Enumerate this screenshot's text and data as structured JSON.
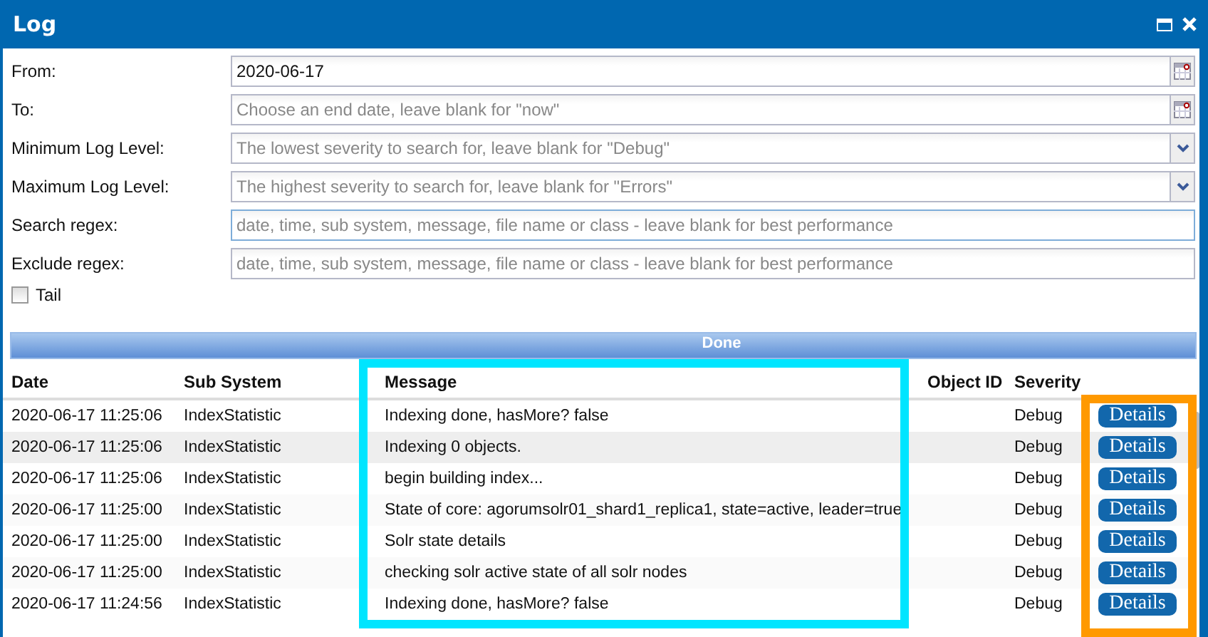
{
  "window": {
    "title": "Log",
    "buttons": [
      {
        "kind": "maximize"
      },
      {
        "kind": "close"
      }
    ]
  },
  "form": {
    "fields": [
      {
        "label": "From:",
        "kind": "date",
        "value": "2020-06-17",
        "focused": false
      },
      {
        "label": "To:",
        "kind": "date",
        "placeholder": "Choose an end date, leave blank for \"now\"",
        "focused": false
      },
      {
        "label": "Minimum Log Level:",
        "kind": "combo",
        "placeholder": "The lowest severity to search for, leave blank for \"Debug\"",
        "focused": false
      },
      {
        "label": "Maximum Log Level:",
        "kind": "combo",
        "placeholder": "The highest severity to search for, leave blank for \"Errors\"",
        "focused": false
      },
      {
        "label": "Search regex:",
        "kind": "text",
        "placeholder": "date, time, sub system, message, file name or class - leave blank for best performance",
        "focused": true
      },
      {
        "label": "Exclude regex:",
        "kind": "text",
        "placeholder": "date, time, sub system, message, file name or class - leave blank for best performance",
        "focused": false
      }
    ],
    "tail": {
      "label": "Tail",
      "checked": false
    }
  },
  "progress": {
    "text": "Done",
    "level": 1
  },
  "table": {
    "columns": [
      "Date",
      "Sub System",
      "Message",
      "Object ID",
      "Severity"
    ],
    "rows": [
      {
        "date": "2020-06-17 11:25:06",
        "sub_system": "IndexStatistic",
        "message": "Indexing done, hasMore? false",
        "severity": "Debug",
        "button": "Details",
        "highlighted": false
      },
      {
        "date": "2020-06-17 11:25:06",
        "sub_system": "IndexStatistic",
        "message": "Indexing 0 objects.",
        "severity": "Debug",
        "button": "Details",
        "highlighted": true
      },
      {
        "date": "2020-06-17 11:25:06",
        "sub_system": "IndexStatistic",
        "message": "begin building index...",
        "severity": "Debug",
        "button": "Details",
        "highlighted": false
      },
      {
        "date": "2020-06-17 11:25:00",
        "sub_system": "IndexStatistic",
        "message": "State of core: agorumsolr01_shard1_replica1, state=active, leader=true",
        "severity": "Debug",
        "button": "Details",
        "highlighted": false
      },
      {
        "date": "2020-06-17 11:25:00",
        "sub_system": "IndexStatistic",
        "message": "Solr state details",
        "severity": "Debug",
        "button": "Details",
        "highlighted": false
      },
      {
        "date": "2020-06-17 11:25:00",
        "sub_system": "IndexStatistic",
        "message": "checking solr active state of all solr nodes",
        "severity": "Debug",
        "button": "Details",
        "highlighted": false
      },
      {
        "date": "2020-06-17 11:24:56",
        "sub_system": "IndexStatistic",
        "message": "Indexing done, hasMore? false",
        "severity": "Debug",
        "button": "Details",
        "highlighted": false
      }
    ]
  },
  "annotations": [
    {
      "color": "#00e5ff"
    },
    {
      "color": "#ff9900"
    }
  ]
}
